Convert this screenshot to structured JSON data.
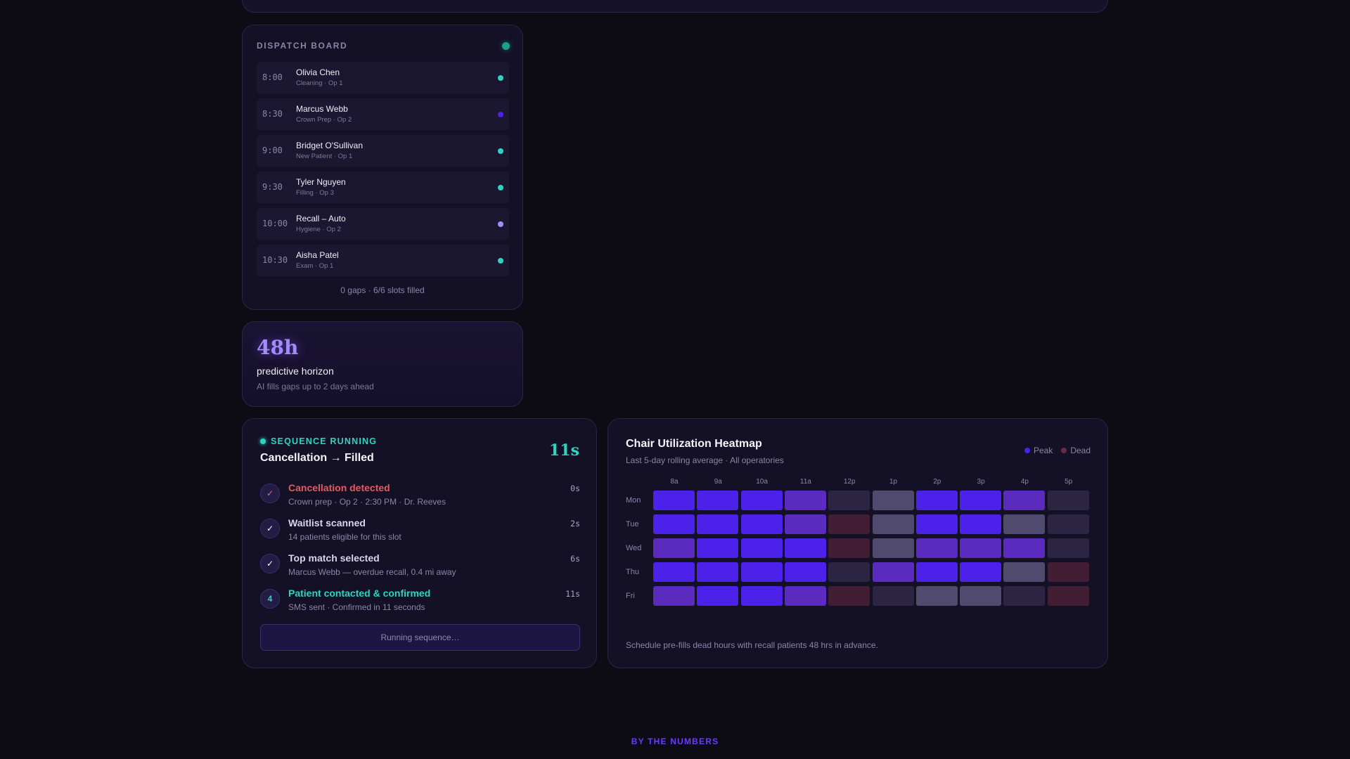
{
  "colors": {
    "peak": "#4c22ea",
    "high": "#5b2bc0",
    "mid": "#4f4a6e",
    "low": "#2b2543",
    "dead": "#421e35",
    "teal": "#2dd4bf",
    "accent_purple": "#a08cff"
  },
  "dispatch": {
    "title": "DISPATCH BOARD",
    "rows": [
      {
        "time": "8:00",
        "name": "Olivia Chen",
        "detail": "Cleaning · Op 1",
        "status_color": "#2dd4bf"
      },
      {
        "time": "8:30",
        "name": "Marcus Webb",
        "detail": "Crown Prep · Op 2",
        "status_color": "#4c22ea"
      },
      {
        "time": "9:00",
        "name": "Bridget O'Sullivan",
        "detail": "New Patient · Op 1",
        "status_color": "#2dd4bf"
      },
      {
        "time": "9:30",
        "name": "Tyler Nguyen",
        "detail": "Filling · Op 3",
        "status_color": "#2dd4bf"
      },
      {
        "time": "10:00",
        "name": "Recall – Auto",
        "detail": "Hygiene · Op 2",
        "status_color": "#a78bfa"
      },
      {
        "time": "10:30",
        "name": "Aisha Patel",
        "detail": "Exam · Op 1",
        "status_color": "#2dd4bf"
      }
    ],
    "footer": "0 gaps · 6/6 slots filled"
  },
  "horizon": {
    "value": "48h",
    "label": "predictive horizon",
    "sublabel": "AI fills gaps up to 2 days ahead"
  },
  "sequence": {
    "status": "SEQUENCE RUNNING",
    "title": "Cancellation → Filled",
    "timer": "11s",
    "steps": [
      {
        "marker": "✓",
        "title": "Cancellation detected",
        "detail": "Crown prep · Op 2 · 2:30 PM · Dr. Reeves",
        "time": "0s",
        "title_color": "#e25c5c",
        "marker_color": "#e86a8c"
      },
      {
        "marker": "✓",
        "title": "Waitlist scanned",
        "detail": "14 patients eligible for this slot",
        "time": "2s",
        "title_color": "#d8d4f0",
        "marker_color": "#ffffff"
      },
      {
        "marker": "✓",
        "title": "Top match selected",
        "detail": "Marcus Webb — overdue recall, 0.4 mi away",
        "time": "6s",
        "title_color": "#d8d4f0",
        "marker_color": "#ffffff"
      },
      {
        "marker": "4",
        "title": "Patient contacted & confirmed",
        "detail": "SMS sent · Confirmed in 11 seconds",
        "time": "11s",
        "title_color": "#2dd4bf",
        "marker_color": "#2dd4bf"
      }
    ],
    "button_label": "Running sequence…"
  },
  "heatmap": {
    "title": "Chair Utilization Heatmap",
    "subtitle": "Last 5-day rolling average · All operatories",
    "legend": [
      {
        "label": "Peak",
        "color": "#4c22ea"
      },
      {
        "label": "Dead",
        "color": "#6b2a45"
      }
    ],
    "columns": [
      "8a",
      "9a",
      "10a",
      "11a",
      "12p",
      "1p",
      "2p",
      "3p",
      "4p",
      "5p"
    ],
    "rows": [
      "Mon",
      "Tue",
      "Wed",
      "Thu",
      "Fri"
    ],
    "levels": [
      [
        "peak",
        "peak",
        "peak",
        "high",
        "low",
        "mid",
        "peak",
        "peak",
        "high",
        "low"
      ],
      [
        "peak",
        "peak",
        "peak",
        "high",
        "dead",
        "mid",
        "peak",
        "peak",
        "mid",
        "low"
      ],
      [
        "high",
        "peak",
        "peak",
        "peak",
        "dead",
        "mid",
        "high",
        "high",
        "high",
        "low"
      ],
      [
        "peak",
        "peak",
        "peak",
        "peak",
        "low",
        "high",
        "peak",
        "peak",
        "mid",
        "dead"
      ],
      [
        "high",
        "peak",
        "peak",
        "high",
        "dead",
        "low",
        "mid",
        "mid",
        "low",
        "dead"
      ]
    ],
    "footer": "Schedule pre-fills dead hours with recall patients 48 hrs in advance."
  },
  "section_label": "BY THE NUMBERS"
}
